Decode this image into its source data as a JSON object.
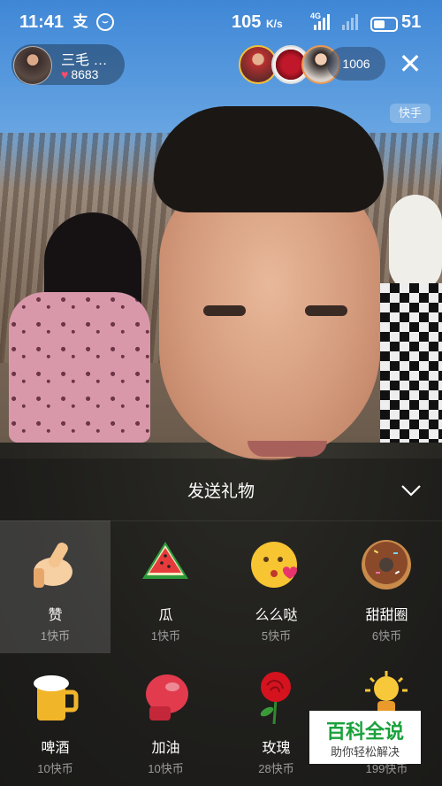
{
  "status_bar": {
    "time": "11:41",
    "speed": "105",
    "speed_unit": "K/s",
    "network": "4G",
    "battery": "51"
  },
  "streamer": {
    "name": "三毛 …",
    "likes": "8683"
  },
  "viewers": {
    "count": "1006"
  },
  "watermark": "快手",
  "gift_panel": {
    "title": "发送礼物",
    "gifts": [
      {
        "name": "赞",
        "price": "1快币",
        "icon": "thumbs-up-icon"
      },
      {
        "name": "瓜",
        "price": "1快币",
        "icon": "watermelon-icon"
      },
      {
        "name": "么么哒",
        "price": "5快币",
        "icon": "kiss-face-icon"
      },
      {
        "name": "甜甜圈",
        "price": "6快币",
        "icon": "donut-icon"
      },
      {
        "name": "啤酒",
        "price": "10快币",
        "icon": "beer-icon"
      },
      {
        "name": "加油",
        "price": "10快币",
        "icon": "boxing-glove-icon"
      },
      {
        "name": "玫瑰",
        "price": "28快币",
        "icon": "rose-icon"
      },
      {
        "name": "",
        "price": "199快币",
        "icon": "trophy-icon"
      }
    ]
  },
  "baike_logo": {
    "title": "百科全说",
    "subtitle": "助你轻松解决"
  },
  "colors": {
    "heart": "#ff4b6b",
    "baike_green": "#1aa13b"
  }
}
